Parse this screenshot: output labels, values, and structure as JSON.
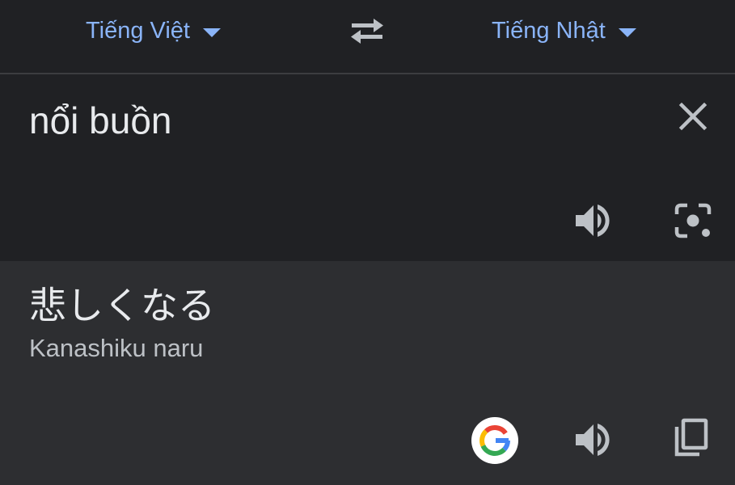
{
  "language_bar": {
    "source_language": "Tiếng Việt",
    "target_language": "Tiếng Nhật"
  },
  "source": {
    "text": "nổi buồn"
  },
  "result": {
    "translation": "悲しくなる",
    "romanization": "Kanashiku naru"
  },
  "icons": {
    "swap": "swap-arrows-icon",
    "clear": "close-icon",
    "speaker": "speaker-icon",
    "camera": "camera-lens-icon",
    "google": "google-logo-icon",
    "copy": "copy-icon"
  },
  "colors": {
    "accent": "#8ab4f8",
    "background": "#202124",
    "result_background": "#2d2e31",
    "text": "#e8eaed",
    "icon": "#bdc1c6"
  }
}
